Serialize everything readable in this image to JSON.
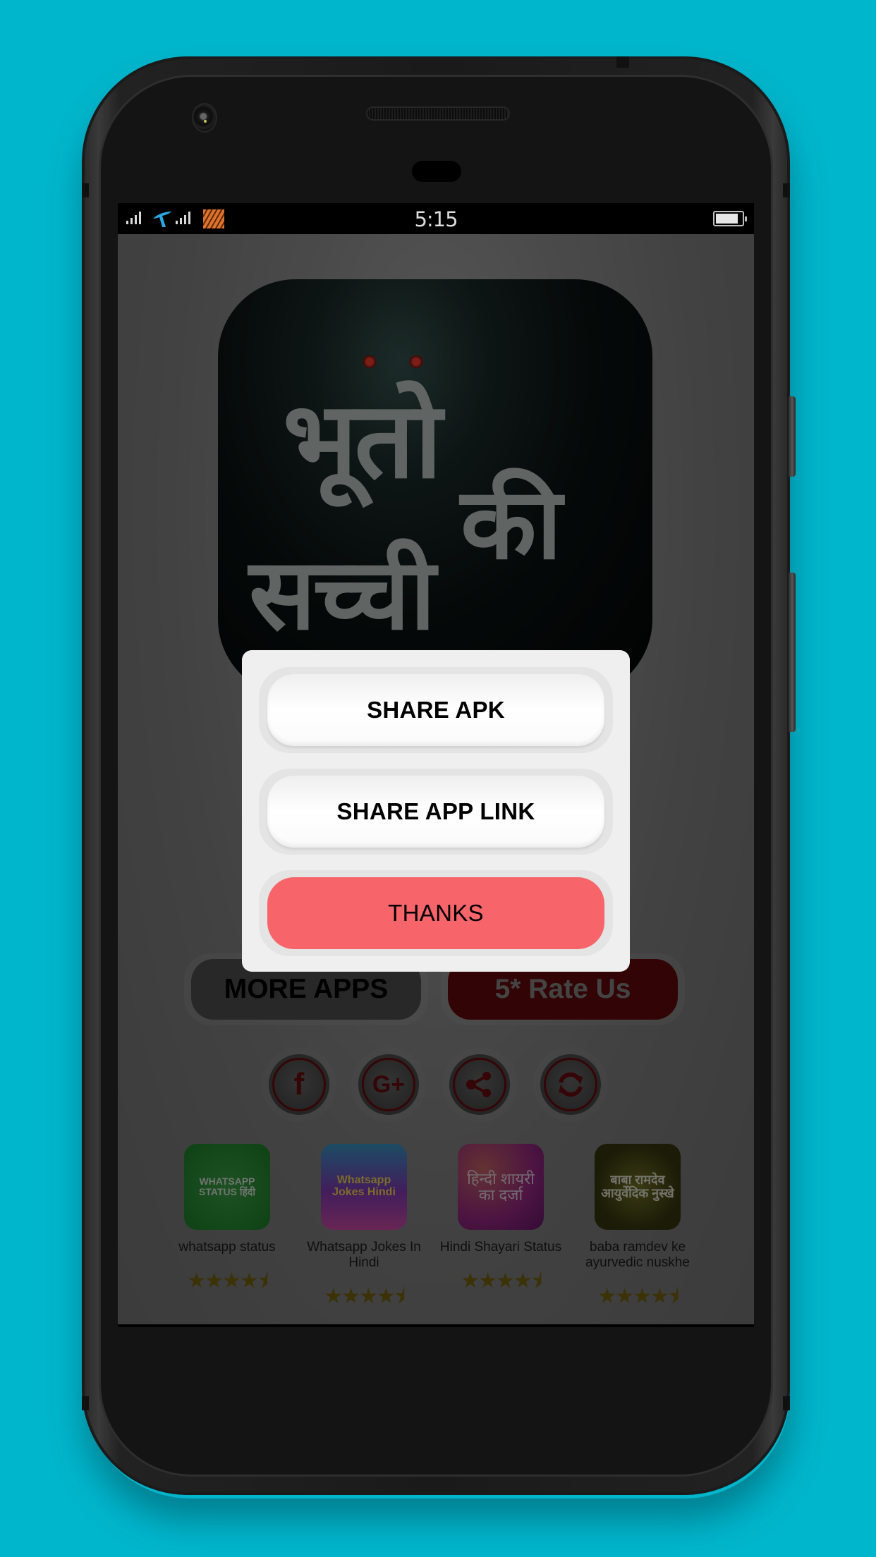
{
  "status_bar": {
    "time": "5:15",
    "battery_level": 0.85,
    "icons": [
      "signal-icon",
      "carrier-icon",
      "signal-icon",
      "tiger-carrier-icon",
      "battery-icon"
    ]
  },
  "app_icon": {
    "title_lines": [
      "भूतो",
      "की",
      "सच्ची"
    ]
  },
  "dialog": {
    "share_apk": "SHARE APK",
    "share_app_link": "SHARE APP LINK",
    "thanks": "THANKS",
    "thanks_color": "#f7646a"
  },
  "actions": {
    "more_apps": "MORE APPS",
    "rate_us": "5* Rate Us",
    "rate_us_color": "#6b090d"
  },
  "social": [
    {
      "name": "facebook",
      "icon": "facebook-icon",
      "glyph": "f"
    },
    {
      "name": "google-plus",
      "icon": "google-plus-icon",
      "glyph": "G+"
    },
    {
      "name": "share",
      "icon": "share-icon",
      "glyph": "share"
    },
    {
      "name": "refresh",
      "icon": "refresh-icon",
      "glyph": "refresh"
    }
  ],
  "recommended_apps": [
    {
      "name": "whatsapp status",
      "icon_text": "WHATSAPP STATUS हिंदी",
      "rating": 4.5
    },
    {
      "name": "Whatsapp Jokes In Hindi",
      "icon_text": "Whatsapp Jokes Hindi",
      "rating": 4.5
    },
    {
      "name": "Hindi Shayari Status",
      "icon_text": "हिन्दी शायरी का दर्जा",
      "rating": 4.5
    },
    {
      "name": "baba ramdev ke ayurvedic nuskhe",
      "icon_text": "बाबा रामदेव आयुर्वेदिक नुस्खे",
      "rating": 4.5
    }
  ],
  "rating_stars": "★★★★⯨"
}
